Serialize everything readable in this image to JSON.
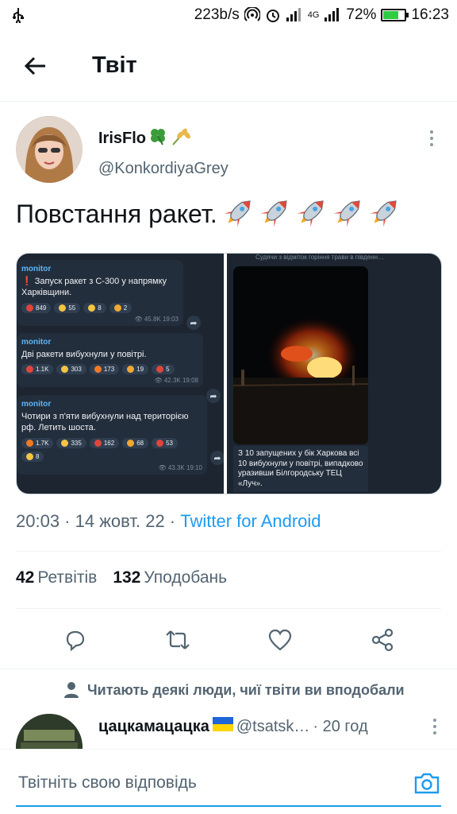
{
  "status_bar": {
    "speed": "223b/s",
    "network": "4G",
    "battery": "72%",
    "battery_level": 0.72,
    "time": "16:23"
  },
  "header": {
    "title": "Твіт"
  },
  "tweet": {
    "author_name": "IrisFlo",
    "author_handle": "@KonkordiyaGrey",
    "text": "Повстання ракет.",
    "media": {
      "messages": [
        {
          "source": "monitor",
          "text": "❗ Запуск ракет з С-300 у напрямку Харківщини.",
          "reactions": [
            {
              "color": "#e0453b",
              "count": "849"
            },
            {
              "color": "#f5c542",
              "count": "55"
            },
            {
              "color": "#f5c542",
              "count": "8"
            },
            {
              "color": "#f0a830",
              "count": "2"
            }
          ],
          "views": "45.8K",
          "time": "19:03"
        },
        {
          "source": "monitor",
          "text": "Дві ракети вибухнули у повітрі.",
          "reactions": [
            {
              "color": "#e0453b",
              "count": "1.1K"
            },
            {
              "color": "#f5c542",
              "count": "303"
            },
            {
              "color": "#f07a24",
              "count": "173"
            },
            {
              "color": "#f0a830",
              "count": "19"
            },
            {
              "color": "#e0453b",
              "count": "5"
            }
          ],
          "views": "42.3K",
          "time": "19:08"
        },
        {
          "source": "monitor",
          "text": "Чотири з п'яти вибухнули над територією рф. Летить шоста.",
          "reactions": [
            {
              "color": "#f07a24",
              "count": "1.7K"
            },
            {
              "color": "#f5c542",
              "count": "335"
            },
            {
              "color": "#e0453b",
              "count": "162"
            },
            {
              "color": "#f0a830",
              "count": "68"
            },
            {
              "color": "#e0453b",
              "count": "53"
            },
            {
              "color": "#f5c542",
              "count": "8"
            }
          ],
          "views": "43.3K",
          "time": "19:10"
        }
      ],
      "right_header": "Судячи з відміток горіння трави в південн…",
      "right_caption": "З 10 запущених у бік Харкова всі 10 вибухнули у повітрі, випадково уразивши Білгородську ТЕЦ «Луч»."
    },
    "timestamp": "20:03 · 14 жовт. 22 · ",
    "source_app": "Twitter for Android",
    "retweets_count": "42",
    "retweets_label": "Ретвітів",
    "likes_count": "132",
    "likes_label": "Уподобань"
  },
  "reply_context": "Читають деякі люди, чиї твіти ви вподобали",
  "reply": {
    "name": "цацкамацацка",
    "handle": "@tsatsk…",
    "age": "· 20 год"
  },
  "compose": {
    "placeholder": "Твітніть свою відповідь"
  }
}
